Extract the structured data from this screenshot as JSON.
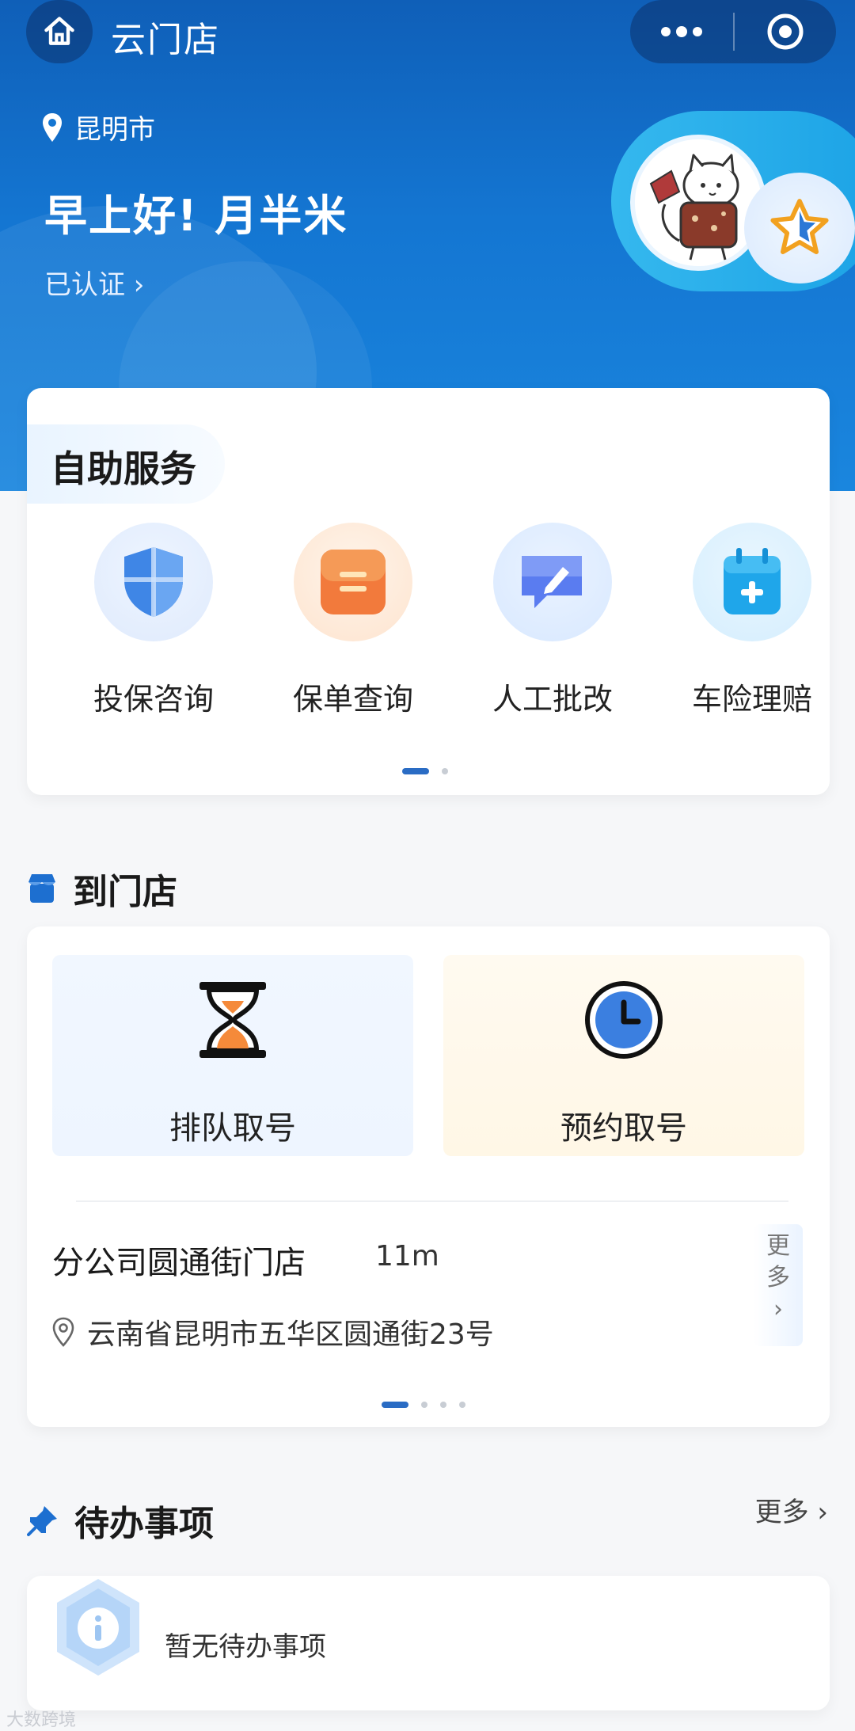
{
  "header": {
    "app_title": "云门店",
    "location": "昆明市",
    "greeting": "早上好! 月半米",
    "verified_label": "已认证 ›"
  },
  "self_service": {
    "title": "自助服务",
    "items": [
      {
        "label": "投保咨询",
        "icon": "shield-icon"
      },
      {
        "label": "保单查询",
        "icon": "policy-doc-icon"
      },
      {
        "label": "人工批改",
        "icon": "edit-message-icon"
      },
      {
        "label": "车险理赔",
        "icon": "calendar-plus-icon"
      }
    ],
    "page_count": 2,
    "active_page": 1
  },
  "store": {
    "title": "到门店",
    "queue_label": "排队取号",
    "appointment_label": "预约取号",
    "name": "分公司圆通街门店",
    "distance": "11m",
    "address": "云南省昆明市五华区圆通街23号",
    "more_line1": "更",
    "more_line2": "多",
    "more_arrow": "›",
    "page_count": 4,
    "active_page": 1
  },
  "todo": {
    "title": "待办事项",
    "more_label": "更多 ›",
    "empty_text": "暂无待办事项"
  },
  "colors": {
    "brand_blue": "#1476d2",
    "accent_blue": "#2a6cc4",
    "orange": "#f58a3a"
  },
  "watermark": "大数跨境"
}
